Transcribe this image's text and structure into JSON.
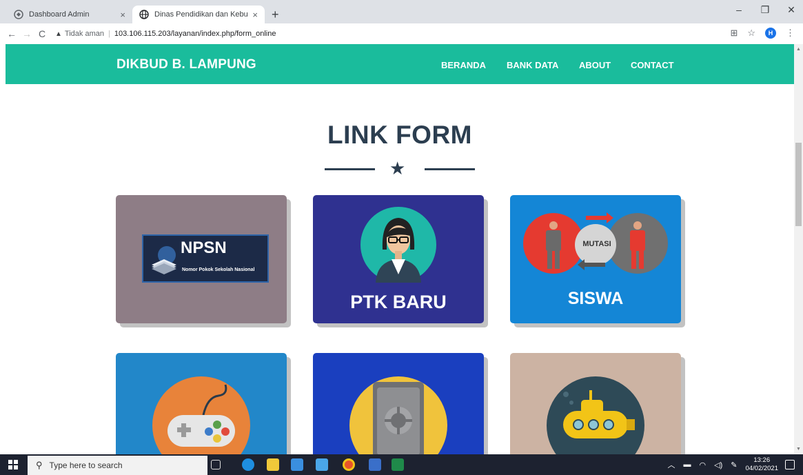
{
  "browser": {
    "tabs": [
      {
        "title": "Dashboard Admin",
        "active": false
      },
      {
        "title": "Dinas Pendidikan dan Kebudayaan",
        "active": true
      }
    ],
    "new_tab_symbol": "+",
    "close_symbol": "×",
    "security_label": "Tidak aman",
    "url": "103.106.115.203/layanan/index.php/form_online",
    "profile_initial": "H"
  },
  "site": {
    "brand": "DIKBUD B. LAMPUNG",
    "menu": [
      "BERANDA",
      "BANK DATA",
      "ABOUT",
      "CONTACT"
    ],
    "heading": "LINK FORM",
    "cards": [
      {
        "id": "npsn",
        "big_text": "NPSN",
        "small_text": "Nomor Pokok Sekolah Nasional"
      },
      {
        "id": "ptk-baru",
        "label": "PTK BARU"
      },
      {
        "id": "mutasi-siswa",
        "badge": "MUTASI",
        "label": "SISWA"
      },
      {
        "id": "game",
        "icon": "gamepad-icon"
      },
      {
        "id": "safe",
        "icon": "safe-icon"
      },
      {
        "id": "submarine",
        "icon": "submarine-icon"
      }
    ]
  },
  "taskbar": {
    "search_placeholder": "Type here to search",
    "time": "13:26",
    "date": "04/02/2021"
  },
  "colors": {
    "navbar": "#1abc9c",
    "heading": "#2c3e50"
  }
}
